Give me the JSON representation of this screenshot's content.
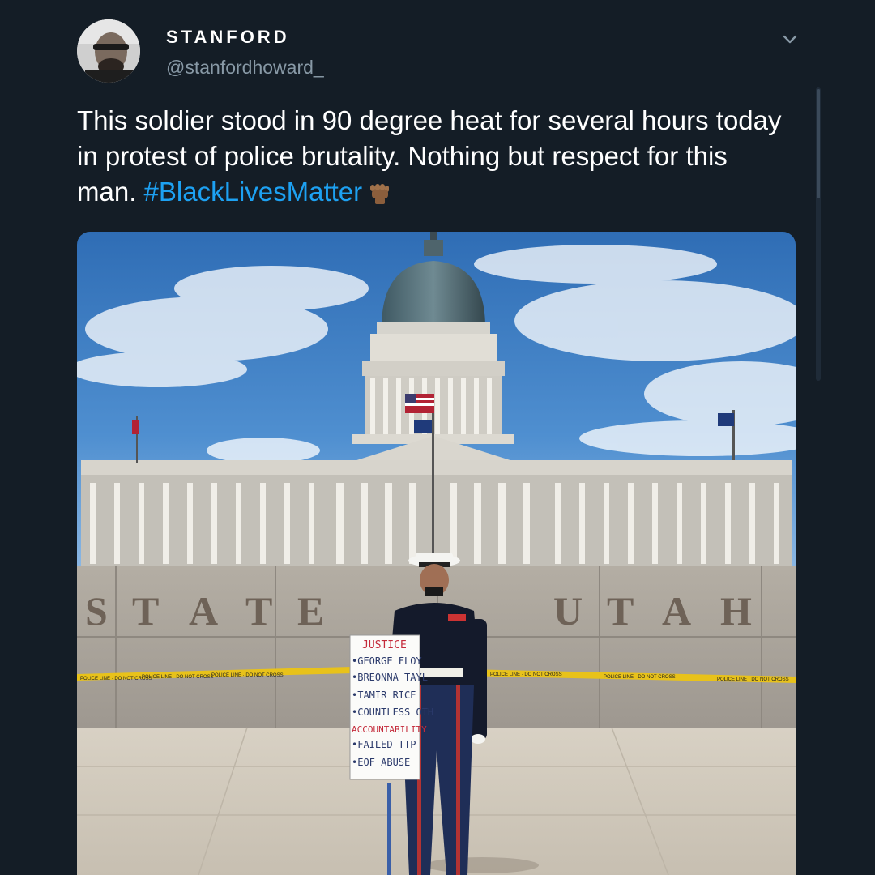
{
  "tweet": {
    "display_name": "STANFORD",
    "handle": "@stanfordhoward_",
    "text": "This soldier stood in 90 degree heat for several hours today in protest of police brutality. Nothing but respect for this man.",
    "hashtag": "#BlackLivesMatter",
    "emoji_icon": "raised-fist-icon"
  },
  "photo": {
    "wall_letters": [
      "S",
      "T",
      "A",
      "T",
      "E",
      "U",
      "T",
      "A",
      "H"
    ],
    "sign_lines": [
      "JUSTICE",
      "•GEORGE FLOY",
      "•BREONNA TAYL",
      "•TAMIR RICE",
      "•COUNTLESS OTH",
      "ACCOUNTABILITY",
      "•FAILED TTP",
      "•EOF ABUSE"
    ],
    "tape_text": "POLICE LINE · DO NOT CROSS"
  },
  "colors": {
    "background": "#141d26",
    "link": "#1da1f2",
    "secondary_text": "#8899a6"
  }
}
